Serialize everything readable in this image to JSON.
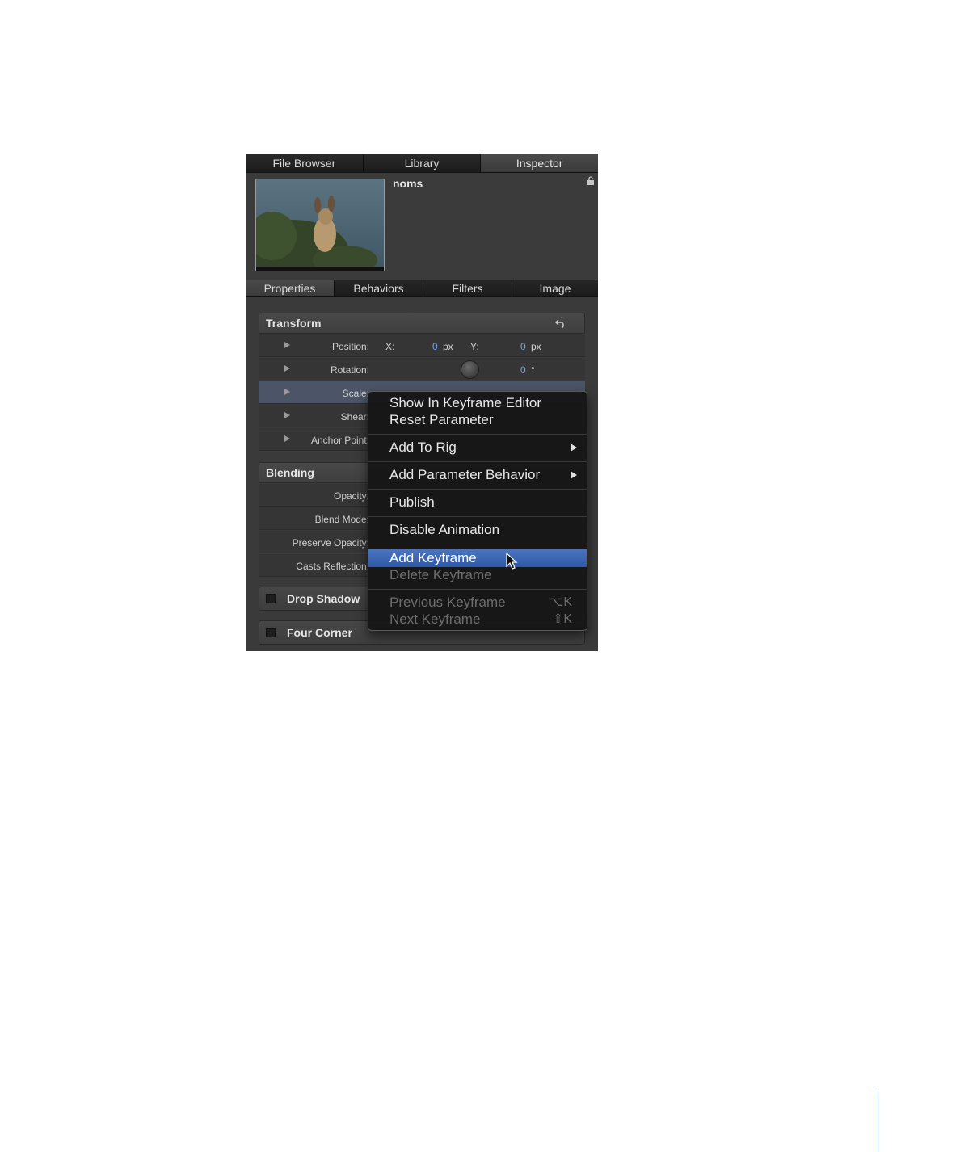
{
  "tabs": [
    "File Browser",
    "Library",
    "Inspector"
  ],
  "object": {
    "name": "noms"
  },
  "subtabs": [
    "Properties",
    "Behaviors",
    "Filters",
    "Image"
  ],
  "transform": {
    "title": "Transform",
    "position": {
      "label": "Position:",
      "x_label": "X:",
      "x_value": "0",
      "x_unit": "px",
      "y_label": "Y:",
      "y_value": "0",
      "y_unit": "px"
    },
    "rotation": {
      "label": "Rotation:",
      "value": "0",
      "unit": "°"
    },
    "scale": {
      "label": "Scale:"
    },
    "shear": {
      "label": "Shear:"
    },
    "anchor": {
      "label": "Anchor Point:"
    }
  },
  "blending": {
    "title": "Blending",
    "opacity": "Opacity:",
    "blend_mode": "Blend Mode:",
    "preserve_opacity": "Preserve Opacity:",
    "casts_reflection": "Casts Reflection:"
  },
  "filters": [
    "Drop Shadow",
    "Four Corner"
  ],
  "menu": {
    "show_in_keyframe_editor": "Show In Keyframe Editor",
    "reset_parameter": "Reset Parameter",
    "add_to_rig": "Add To Rig",
    "add_parameter_behavior": "Add Parameter Behavior",
    "publish": "Publish",
    "disable_animation": "Disable Animation",
    "add_keyframe": "Add Keyframe",
    "delete_keyframe": "Delete Keyframe",
    "previous_keyframe": "Previous Keyframe",
    "previous_shortcut": "⌥K",
    "next_keyframe": "Next Keyframe",
    "next_shortcut": "⇧K"
  },
  "colors": {
    "accent": "#3b66b4",
    "value_blue": "#7aa0ea"
  }
}
